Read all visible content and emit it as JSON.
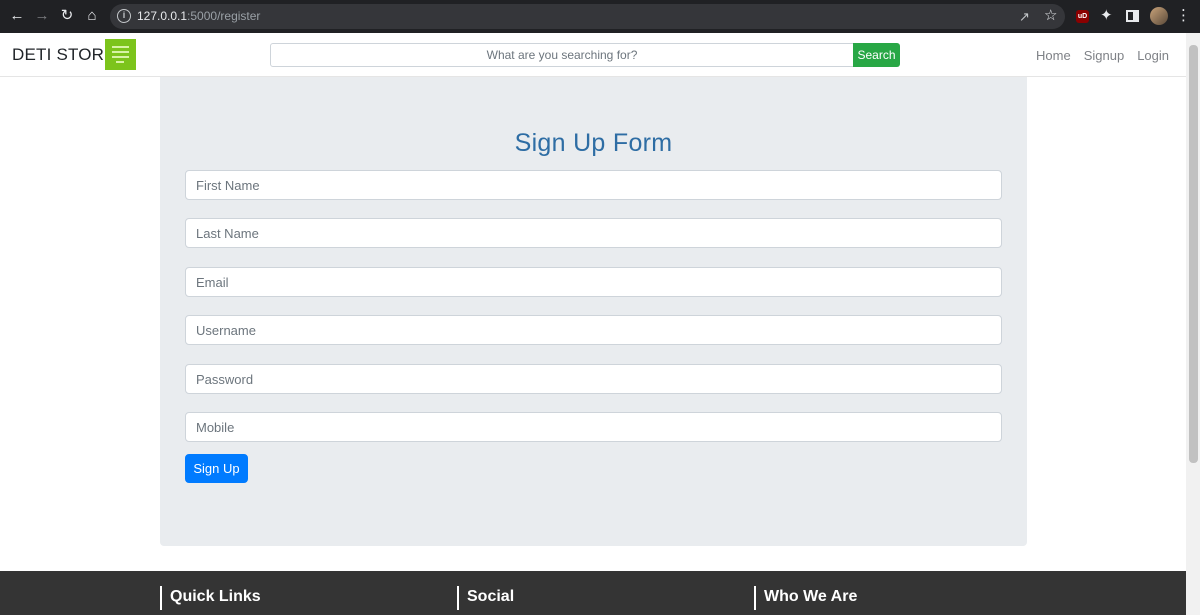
{
  "browser": {
    "url_host": "127.0.0.1",
    "url_path": ":5000/register",
    "menu_glyph": "⋮",
    "extension_label": "uD"
  },
  "navbar": {
    "brand": "DETI STORE",
    "search_placeholder": "What are you searching for?",
    "search_button": "Search",
    "links": [
      "Home",
      "Signup",
      "Login"
    ]
  },
  "form": {
    "title": "Sign Up Form",
    "fields": [
      {
        "placeholder": "First Name"
      },
      {
        "placeholder": "Last Name"
      },
      {
        "placeholder": "Email"
      },
      {
        "placeholder": "Username"
      },
      {
        "placeholder": "Password"
      },
      {
        "placeholder": "Mobile"
      }
    ],
    "submit_label": "Sign Up"
  },
  "footer": {
    "headings": [
      "Quick Links",
      "Social",
      "Who We Are"
    ]
  },
  "colors": {
    "chrome_bg": "#202124",
    "brand_logo": "#7cc41c",
    "search_button": "#28a745",
    "panel_bg": "#e9ecef",
    "title": "#2e6da4",
    "primary_button": "#007bff",
    "footer_bg": "#343434"
  },
  "icons": {
    "back": "arrow-left-icon",
    "forward": "arrow-right-icon",
    "reload": "reload-icon",
    "home": "home-icon",
    "info": "info-icon",
    "share": "share-icon",
    "bookmark": "star-icon",
    "extension": "ublock-icon",
    "extensions": "puzzle-icon",
    "side_panel": "side-panel-icon",
    "profile": "avatar",
    "menu": "kebab-menu-icon"
  }
}
